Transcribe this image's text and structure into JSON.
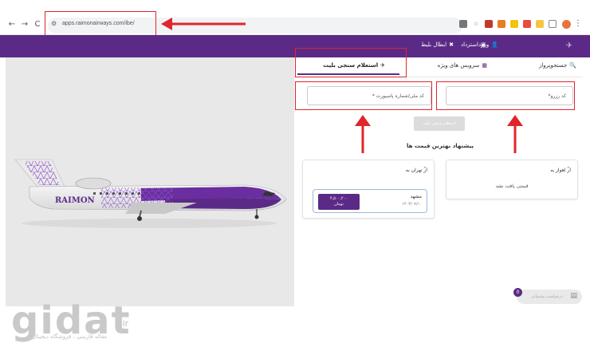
{
  "browser": {
    "url": "apps.raimonairways.com/ibe/",
    "back": "←",
    "forward": "→",
    "reload": "C"
  },
  "header": {
    "login": "ورود",
    "cancel": "ابطال بلیط",
    "refund": "استرداد"
  },
  "hero": {
    "brand_on_plane": "RAIMON"
  },
  "tabs": {
    "flight_search": "جستجوپرواز",
    "special_services": "سرویس های ویژه",
    "ticket_inquiry": "استعلام سنجی بلیت"
  },
  "form": {
    "reservation_code": "کد رزرو*",
    "national_id": "کد ملی/شماره پاسپورت *",
    "inquiry_button": "استعلام سنجی بلیت"
  },
  "best_prices": {
    "title": "پیشنهاد بهترین قیمت ها",
    "from_ahvaz": "از اهواز به",
    "no_price": "قیمتی یافت نشد",
    "from_tehran": "از تهران به",
    "offer_city": "مشهد",
    "offer_date": "۱۴۰۳/۰۷/۱۰",
    "offer_price": "۴,۵۰۰,۲۰۰",
    "offer_currency": "تومان"
  },
  "chat": {
    "badge": "0",
    "label": "درخواست پشتیبانی"
  },
  "watermark": {
    "logo": "gidat",
    "domain": ".ir",
    "tagline": "مقاله فارسی ، فروشگاه دیجیتال"
  },
  "colors": {
    "brand_purple": "#5b2a86",
    "annotation_red": "#e0262d"
  }
}
